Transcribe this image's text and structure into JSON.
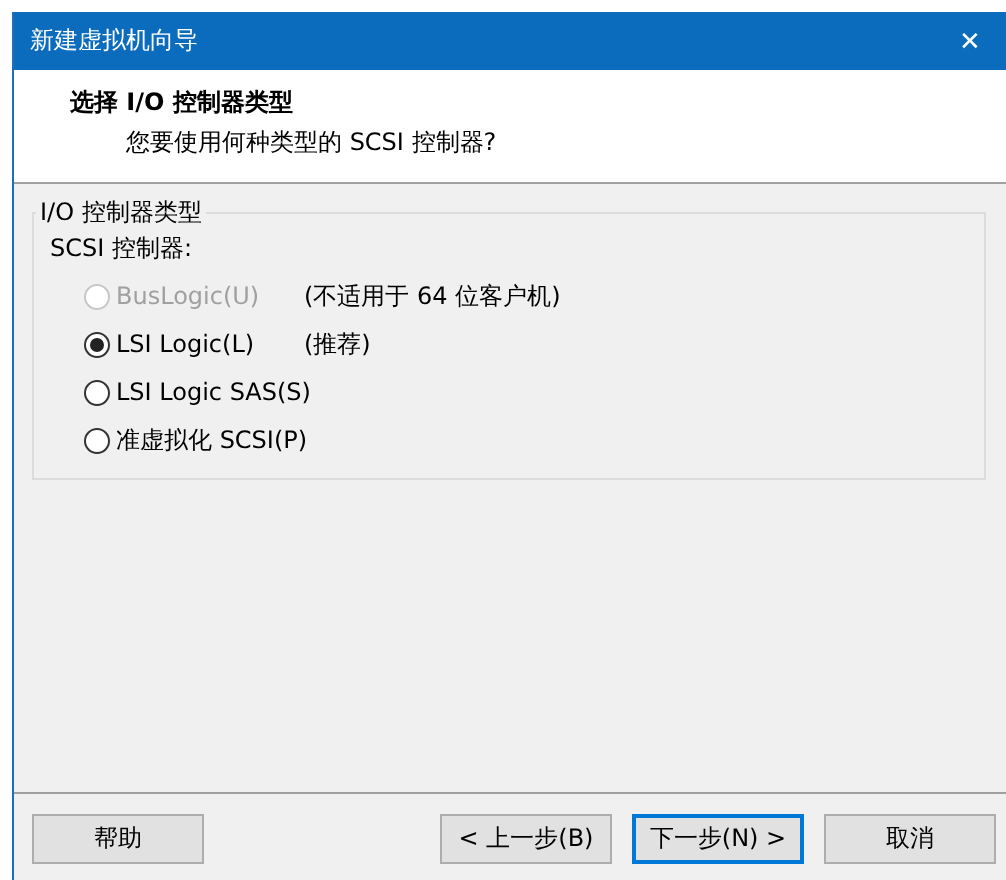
{
  "window": {
    "title": "新建虚拟机向导",
    "close": "✕"
  },
  "header": {
    "title": "选择 I/O 控制器类型",
    "subtitle": "您要使用何种类型的 SCSI 控制器?"
  },
  "group": {
    "title": "I/O 控制器类型",
    "label": "SCSI 控制器:",
    "options": [
      {
        "label": "BusLogic(U)",
        "note": "(不适用于 64 位客户机)",
        "selected": false,
        "disabled": true
      },
      {
        "label": "LSI Logic(L)",
        "note": "(推荐)",
        "selected": true,
        "disabled": false
      },
      {
        "label": "LSI Logic SAS(S)",
        "selected": false,
        "disabled": false
      },
      {
        "label": "准虚拟化 SCSI(P)",
        "selected": false,
        "disabled": false
      }
    ]
  },
  "buttons": [
    {
      "label": "帮助",
      "default": false
    },
    {
      "label": "< 上一步(B)",
      "default": false
    },
    {
      "label": "下一步(N) >",
      "default": true
    },
    {
      "label": "取消",
      "default": false
    }
  ]
}
